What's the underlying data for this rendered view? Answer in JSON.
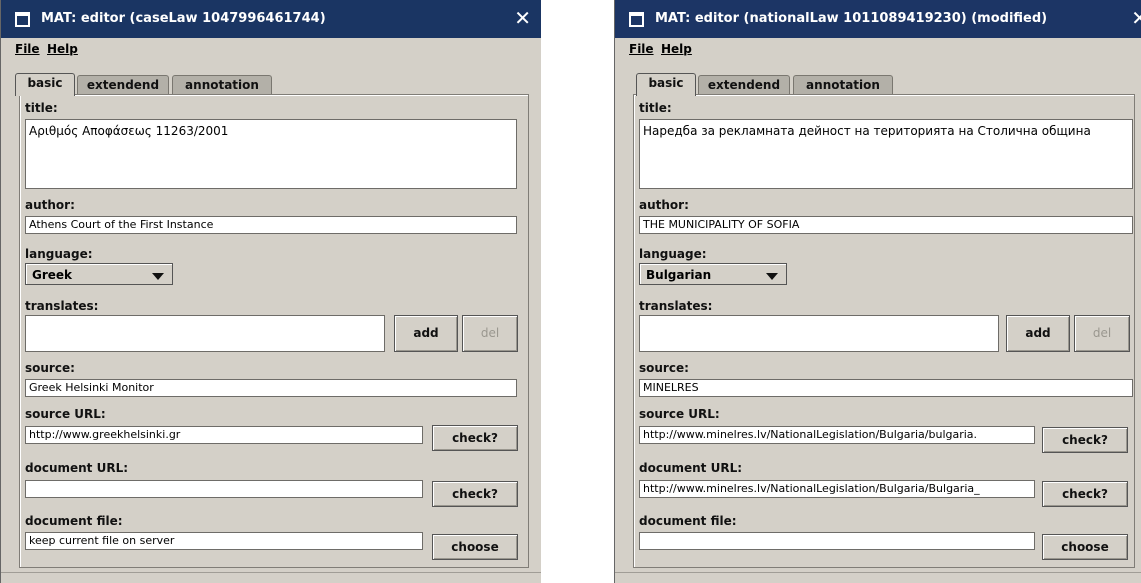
{
  "windows": [
    {
      "title": "MAT: editor (caseLaw 1047996461744)",
      "close": "✕",
      "menu": [
        "File",
        "Help"
      ],
      "tabs": [
        "basic",
        "extendend",
        "annotation"
      ],
      "labels": {
        "title": "title:",
        "author": "author:",
        "language": "language:",
        "translates": "translates:",
        "source": "source:",
        "source_url": "source URL:",
        "document_url": "document URL:",
        "document_file": "document file:"
      },
      "values": {
        "title": "Αριθμός Αποφάσεως 11263/2001",
        "author": "Athens Court of the First Instance",
        "language": "Greek",
        "translates": "",
        "source": "Greek Helsinki Monitor",
        "source_url": "http://www.greekhelsinki.gr",
        "document_url": "",
        "document_file": "keep current file on server"
      },
      "buttons": {
        "add": "add",
        "del": "del",
        "check1": "check?",
        "check2": "check?",
        "choose": "choose"
      }
    },
    {
      "title": "MAT: editor (nationalLaw 1011089419230) (modified)",
      "close": "✕",
      "menu": [
        "File",
        "Help"
      ],
      "tabs": [
        "basic",
        "extendend",
        "annotation"
      ],
      "labels": {
        "title": "title:",
        "author": "author:",
        "language": "language:",
        "translates": "translates:",
        "source": "source:",
        "source_url": "source URL:",
        "document_url": "document URL:",
        "document_file": "document file:"
      },
      "values": {
        "title": "Наредба за рекламната дейност на територията на Столична община",
        "author": "THE MUNICIPALITY OF SOFIA",
        "language": "Bulgarian",
        "translates": "",
        "source": "MINELRES",
        "source_url": "http://www.minelres.lv/NationalLegislation/Bulgaria/bulgaria.",
        "document_url": "http://www.minelres.lv/NationalLegislation/Bulgaria/Bulgaria_",
        "document_file": ""
      },
      "buttons": {
        "add": "add",
        "del": "del",
        "check1": "check?",
        "check2": "check?",
        "choose": "choose"
      }
    }
  ]
}
